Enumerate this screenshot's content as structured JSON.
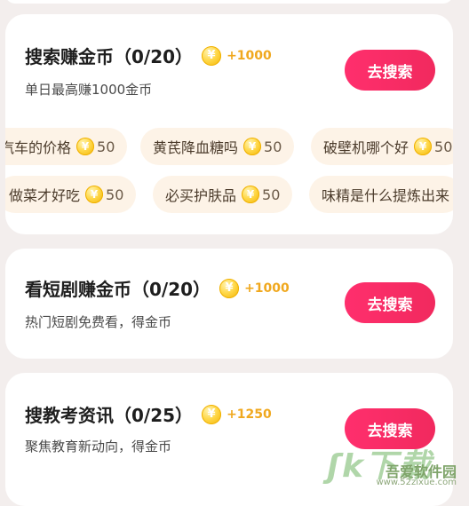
{
  "tasks": [
    {
      "title": "搜索赚金币（0/20）",
      "reward": "+1000",
      "subtitle": "单日最高赚1000金币",
      "button": "去搜索"
    },
    {
      "title": "看短剧赚金币（0/20）",
      "reward": "+1000",
      "subtitle": "热门短剧免费看，得金币",
      "button": "去搜索"
    },
    {
      "title": "搜教考资讯（0/25）",
      "reward": "+1250",
      "subtitle": "聚焦教育新动向，得金币",
      "button": "去搜索"
    }
  ],
  "search_tags": {
    "row1": [
      {
        "text": "汽车的价格",
        "points": "50"
      },
      {
        "text": "黄芪降血糖吗",
        "points": "50"
      },
      {
        "text": "破壁机哪个好",
        "points": "50"
      }
    ],
    "row2": [
      {
        "text": "做菜才好吃",
        "points": "50"
      },
      {
        "text": "必买护肤品",
        "points": "50"
      },
      {
        "text": "味精是什么提炼出来",
        "points": ""
      }
    ]
  },
  "coin_glyph": "¥",
  "watermark": {
    "mark": "ʃk下载",
    "name": "吾爱软件园",
    "url": "www.52zixue.com"
  },
  "colors": {
    "accent": "#ff2f6d",
    "reward": "#f0a81e",
    "tag_bg": "#fdf3e7",
    "background": "#f3eeed"
  }
}
